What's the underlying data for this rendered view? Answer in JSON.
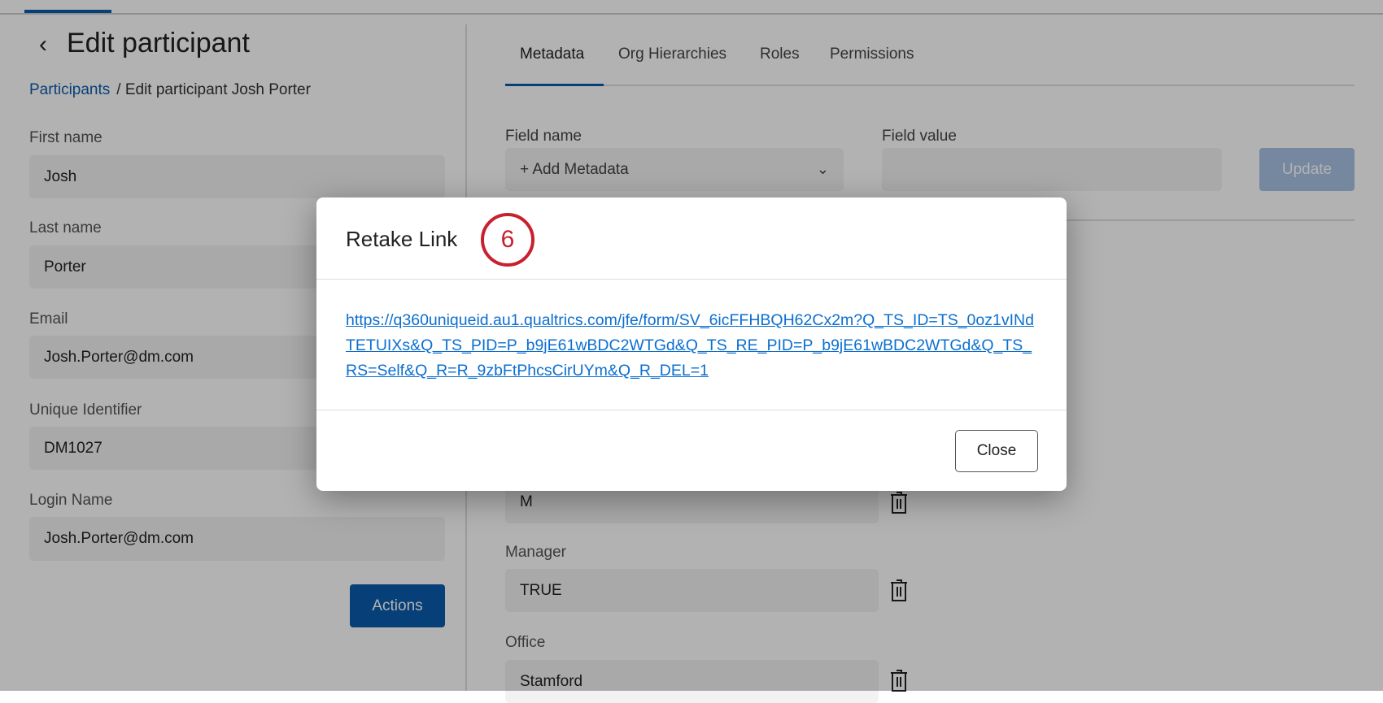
{
  "header": {
    "back_icon": "chevron-left-icon",
    "title": "Edit participant"
  },
  "breadcrumb": {
    "parent": "Participants",
    "current": "/ Edit participant Josh Porter"
  },
  "form": {
    "first_name": {
      "label": "First name",
      "value": "Josh"
    },
    "last_name": {
      "label": "Last name",
      "value": "Porter"
    },
    "email": {
      "label": "Email",
      "value": "Josh.Porter@dm.com"
    },
    "unique_id": {
      "label": "Unique Identifier",
      "value": "DM1027"
    },
    "login_name": {
      "label": "Login Name",
      "value": "Josh.Porter@dm.com"
    },
    "actions_label": "Actions"
  },
  "tabs": [
    "Metadata",
    "Org Hierarchies",
    "Roles",
    "Permissions"
  ],
  "metadata": {
    "field_name_label": "Field name",
    "field_name_placeholder": "+ Add Metadata",
    "field_value_label": "Field value",
    "update_label": "Update",
    "rows": [
      {
        "label": "",
        "value": "M"
      },
      {
        "label": "Manager",
        "value": "TRUE"
      },
      {
        "label": "Office",
        "value": "Stamford"
      }
    ]
  },
  "modal": {
    "title": "Retake Link",
    "step_badge": "6",
    "link": "https://q360uniqueid.au1.qualtrics.com/jfe/form/SV_6icFFHBQH62Cx2m?Q_TS_ID=TS_0oz1vINdTETUIXs&Q_TS_PID=P_b9jE61wBDC2WTGd&Q_TS_RE_PID=P_b9jE61wBDC2WTGd&Q_TS_RS=Self&Q_R=R_9zbFtPhcsCirUYm&Q_R_DEL=1",
    "close_label": "Close"
  },
  "colors": {
    "accent": "#0b5cad",
    "badge": "#c8202f",
    "link": "#0b6fd0"
  }
}
